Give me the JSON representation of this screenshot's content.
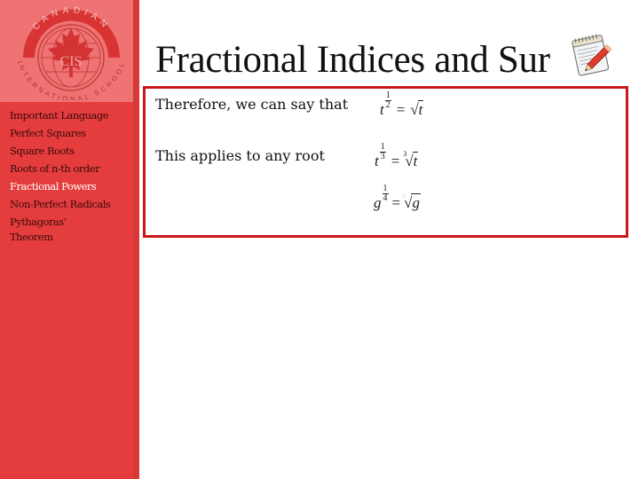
{
  "header": {
    "title": "Fractional Indices and Sur"
  },
  "logo": {
    "top_arc_text": "CANADIAN",
    "center_text": "CIS",
    "bottom_arc_text": "INTERNATIONAL SCHOOL"
  },
  "sidebar": {
    "items": [
      {
        "label": "Important Language",
        "active": false
      },
      {
        "label": "Perfect Squares",
        "active": false
      },
      {
        "label": "Square Roots",
        "active": false
      },
      {
        "label": "Roots of n-th order",
        "active": false
      },
      {
        "label": "Fractional Powers",
        "active": true
      },
      {
        "label": "Non-Perfect Radicals",
        "active": false
      },
      {
        "label": "Pythagoras' Theorem",
        "active": false
      }
    ]
  },
  "content": {
    "rows": [
      {
        "text": "Therefore, we can say that",
        "formula": {
          "base": "t",
          "num": "1",
          "den": "2",
          "root_index": "",
          "radicand": "t"
        }
      },
      {
        "text": "This applies to any root",
        "formula": {
          "base": "t",
          "num": "1",
          "den": "3",
          "root_index": "3",
          "radicand": "t"
        }
      },
      {
        "text": "",
        "formula": {
          "base": "g",
          "num": "1",
          "den": "4",
          "root_index": "4",
          "radicand": "g"
        }
      }
    ],
    "equals": "="
  },
  "colors": {
    "sidebar": "#e53d3d",
    "logo_bg": "#ef7373",
    "border": "#c8181c",
    "active_nav": "#ffffff",
    "nav_text": "#3a0a0a"
  }
}
